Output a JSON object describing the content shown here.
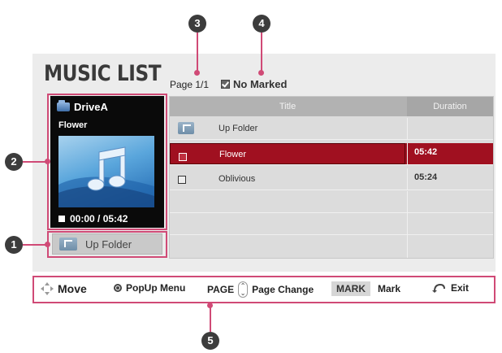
{
  "screen": {
    "title": "MUSIC LIST",
    "page_indicator": "Page 1/1",
    "marked_status": "No Marked"
  },
  "preview": {
    "drive_label": "DriveA",
    "song_title": "Flower",
    "time": "00:00 / 05:42"
  },
  "up_folder_button": {
    "label": "Up Folder"
  },
  "list": {
    "columns": [
      "Title",
      "Duration"
    ],
    "rows": [
      {
        "type": "folder",
        "title": "Up Folder",
        "duration": ""
      },
      {
        "type": "file",
        "title": "Flower",
        "duration": "05:42",
        "selected": true
      },
      {
        "type": "file",
        "title": "Oblivious",
        "duration": "05:24"
      }
    ]
  },
  "help_bar": {
    "move": "Move",
    "popup": "PopUp Menu",
    "page_key": "PAGE",
    "page_change": "Page Change",
    "mark_key": "MARK",
    "mark": "Mark",
    "exit": "Exit"
  },
  "callouts": [
    "1",
    "2",
    "3",
    "4",
    "5"
  ],
  "colors": {
    "accent": "#d04a76",
    "selected_row": "#a01020"
  }
}
